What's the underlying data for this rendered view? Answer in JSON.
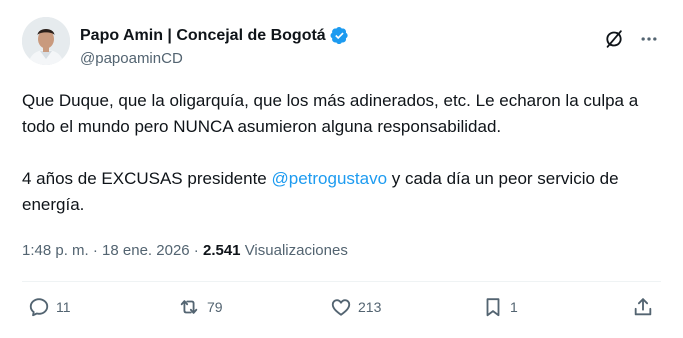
{
  "author": {
    "display_name": "Papo Amin | Concejal de Bogotá",
    "handle": "@papoaminCD",
    "verified": true,
    "verified_color": "#1d9bf0"
  },
  "tweet": {
    "paragraph1": "Que Duque, que la oligarquía, que los más adinerados, etc. Le echaron la culpa a todo el mundo pero NUNCA asumieron alguna responsabilidad.",
    "paragraph2_before": "4 años de EXCUSAS presidente ",
    "mention": "@petrogustavo",
    "paragraph2_after": " y cada día un peor servicio de energía."
  },
  "meta": {
    "time": "1:48 p. m.",
    "separator": " · ",
    "date": "18 ene. 2026",
    "views_count": "2.541",
    "views_label": "Visualizaciones"
  },
  "actions": {
    "replies": "11",
    "reposts": "79",
    "likes": "213",
    "bookmarks": "1"
  },
  "colors": {
    "text": "#0f1419",
    "secondary": "#536471",
    "accent": "#1d9bf0",
    "divider": "#eff3f4"
  },
  "icons": [
    "grok-icon",
    "more-icon",
    "reply-icon",
    "repost-icon",
    "like-icon",
    "bookmark-icon",
    "share-icon"
  ]
}
